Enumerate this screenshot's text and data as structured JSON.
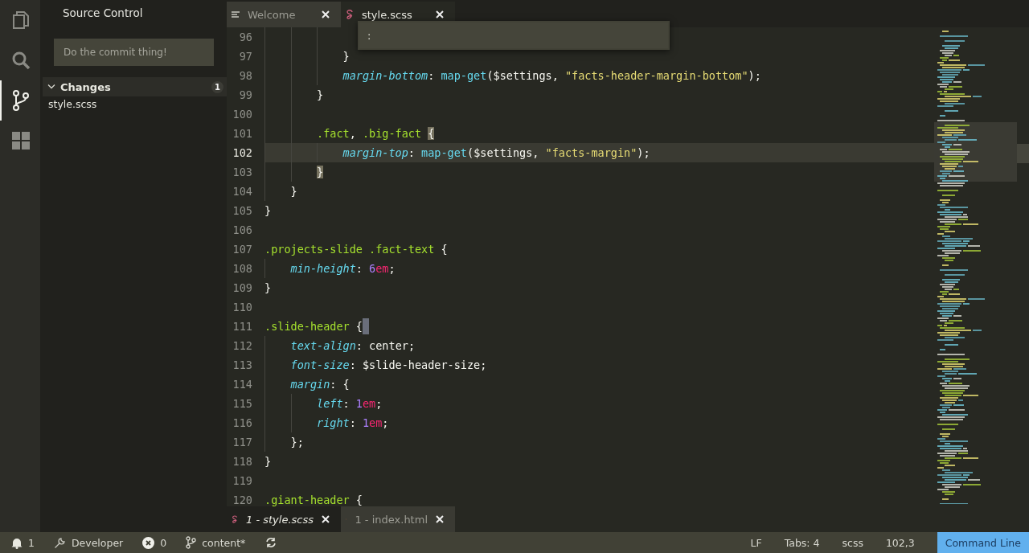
{
  "activity_bar": [
    {
      "kind": "files",
      "selected": false
    },
    {
      "kind": "search",
      "selected": false
    },
    {
      "kind": "source-control",
      "selected": true
    },
    {
      "kind": "extensions",
      "selected": false
    }
  ],
  "sidebar": {
    "title": "Source Control",
    "commit_message": {
      "placeholder": "Do the commit thing!"
    },
    "changes": {
      "label": "Changes",
      "count": "1",
      "expanded": true,
      "files": [
        "style.scss"
      ]
    }
  },
  "top_tabs": [
    {
      "label": "Welcome",
      "kind": "text",
      "selected": false
    },
    {
      "label": "style.scss",
      "kind": "sass",
      "selected": true
    }
  ],
  "command_input": {
    "value": ":"
  },
  "editor": {
    "lines": [
      {
        "number": "96",
        "current": false
      },
      {
        "number": "97",
        "current": false,
        "text": "            }",
        "bracket_match": false,
        "cursor_at_end": false
      },
      {
        "number": "98",
        "current": false,
        "text": "            margin-bottom: map-get($settings, \"facts-header-margin-bottom\");",
        "cursor_at_end": false
      },
      {
        "number": "99",
        "current": false,
        "text": "        }",
        "bracket_match": false,
        "cursor_at_end": false
      },
      {
        "number": "100",
        "current": false
      },
      {
        "number": "101",
        "current": false,
        "text": "        .fact, .big-fact {",
        "bracket_match": true,
        "cursor_at_end": false
      },
      {
        "number": "102",
        "current": true,
        "text": "            margin-top: map-get($settings, \"facts-margin\");",
        "cursor_at_end": false
      },
      {
        "number": "103",
        "current": false,
        "text": "        }",
        "bracket_match": true,
        "cursor_at_end": false
      },
      {
        "number": "104",
        "current": false,
        "text": "    }",
        "bracket_match": false,
        "cursor_at_end": false
      },
      {
        "number": "105",
        "current": false,
        "text": "}",
        "bracket_match": false,
        "cursor_at_end": false
      },
      {
        "number": "106",
        "current": false
      },
      {
        "number": "107",
        "current": false,
        "text": ".projects-slide .fact-text {",
        "bracket_match": false,
        "cursor_at_end": false
      },
      {
        "number": "108",
        "current": false,
        "text": "    min-height: 6em;",
        "cursor_at_end": false
      },
      {
        "number": "109",
        "current": false,
        "text": "}",
        "bracket_match": false,
        "cursor_at_end": false
      },
      {
        "number": "110",
        "current": false
      },
      {
        "number": "111",
        "current": false,
        "text": ".slide-header {",
        "bracket_match": false,
        "cursor_at_end": true
      },
      {
        "number": "112",
        "current": false,
        "text": "    text-align: center;",
        "cursor_at_end": false
      },
      {
        "number": "113",
        "current": false,
        "text": "    font-size: $slide-header-size;",
        "cursor_at_end": false
      },
      {
        "number": "114",
        "current": false,
        "text": "    margin: {",
        "bracket_match": false,
        "cursor_at_end": false
      },
      {
        "number": "115",
        "current": false,
        "text": "        left: 1em;",
        "cursor_at_end": false
      },
      {
        "number": "116",
        "current": false,
        "text": "        right: 1em;",
        "cursor_at_end": false
      },
      {
        "number": "117",
        "current": false,
        "text": "    };",
        "bracket_match": false,
        "cursor_at_end": false
      },
      {
        "number": "118",
        "current": false,
        "text": "}",
        "bracket_match": false,
        "cursor_at_end": false
      },
      {
        "number": "119",
        "current": false
      },
      {
        "number": "120",
        "current": false,
        "text": ".giant-header {",
        "bracket_match": false,
        "cursor_at_end": false
      }
    ]
  },
  "bottom_tabs": [
    {
      "label": "1 - style.scss",
      "kind": "sass",
      "selected": true
    },
    {
      "label": "1 - index.html",
      "kind": "html",
      "selected": false
    }
  ],
  "status_bar": {
    "left": [
      {
        "kind": "bell",
        "text": "1"
      },
      {
        "kind": "wrench",
        "text": "Developer"
      },
      {
        "kind": "error",
        "text": "0"
      },
      {
        "kind": "branch",
        "text": "content*"
      },
      {
        "kind": "sync"
      }
    ],
    "right": [
      {
        "text": "LF"
      },
      {
        "text": "Tabs: 4"
      },
      {
        "text": "scss"
      },
      {
        "text": "102,3"
      }
    ],
    "mode_button": "Command Line"
  }
}
